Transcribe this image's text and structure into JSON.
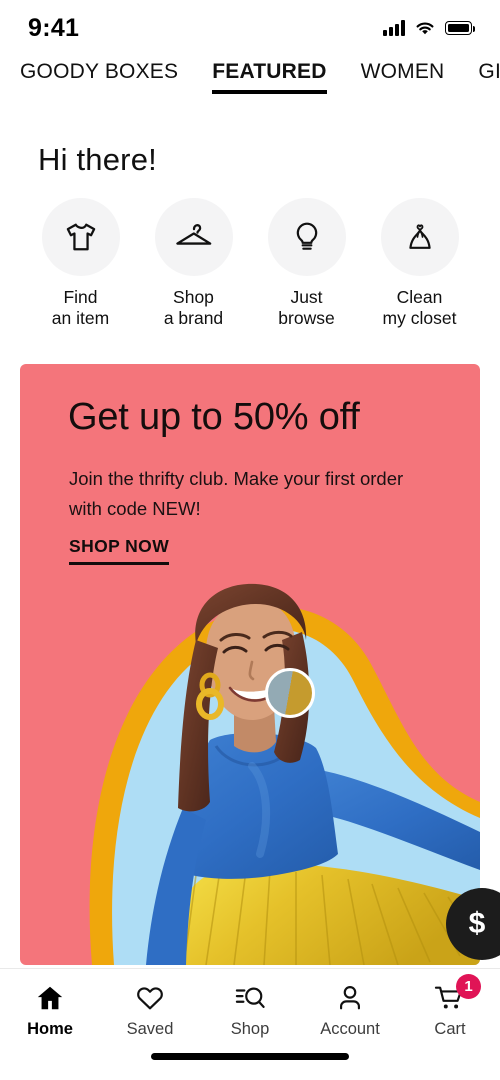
{
  "status_bar": {
    "time": "9:41",
    "cellular_icon": "signal-bars-icon",
    "wifi_icon": "wifi-icon",
    "battery_icon": "battery-full-icon"
  },
  "top_tabs": {
    "items": [
      {
        "label": "GOODY BOXES",
        "active": false
      },
      {
        "label": "FEATURED",
        "active": true
      },
      {
        "label": "WOMEN",
        "active": false
      },
      {
        "label": "GIRL",
        "active": false
      }
    ]
  },
  "greeting": {
    "text": "Hi there!"
  },
  "quick_actions": {
    "items": [
      {
        "icon": "tshirt-icon",
        "line1": "Find",
        "line2": "an item"
      },
      {
        "icon": "hanger-icon",
        "line1": "Shop",
        "line2": "a brand"
      },
      {
        "icon": "lightbulb-icon",
        "line1": "Just",
        "line2": "browse"
      },
      {
        "icon": "laundry-bag-icon",
        "line1": "Clean",
        "line2": "my closet"
      }
    ]
  },
  "promo": {
    "background_color": "#F4757B",
    "title": "Get up to 50% off",
    "subtitle": "Join the thrifty club. Make your first order with code NEW!",
    "cta_label": "SHOP NOW",
    "hero_alt": "smiling-woman-blue-sweater-yellow-skirt",
    "hotspot": "product-tag-hotspot",
    "halo_colors": [
      "#EFA70C",
      "#AEDDF5"
    ]
  },
  "floating_action": {
    "label": "$",
    "icon": "dollar-icon",
    "background_color": "#1C1C1C"
  },
  "bottom_nav": {
    "items": [
      {
        "icon": "home-icon",
        "label": "Home",
        "active": true,
        "badge": ""
      },
      {
        "icon": "heart-icon",
        "label": "Saved",
        "active": false,
        "badge": ""
      },
      {
        "icon": "search-icon",
        "label": "Shop",
        "active": false,
        "badge": ""
      },
      {
        "icon": "person-icon",
        "label": "Account",
        "active": false,
        "badge": ""
      },
      {
        "icon": "cart-icon",
        "label": "Cart",
        "active": false,
        "badge": "1"
      }
    ],
    "badge_color": "#E01456"
  }
}
